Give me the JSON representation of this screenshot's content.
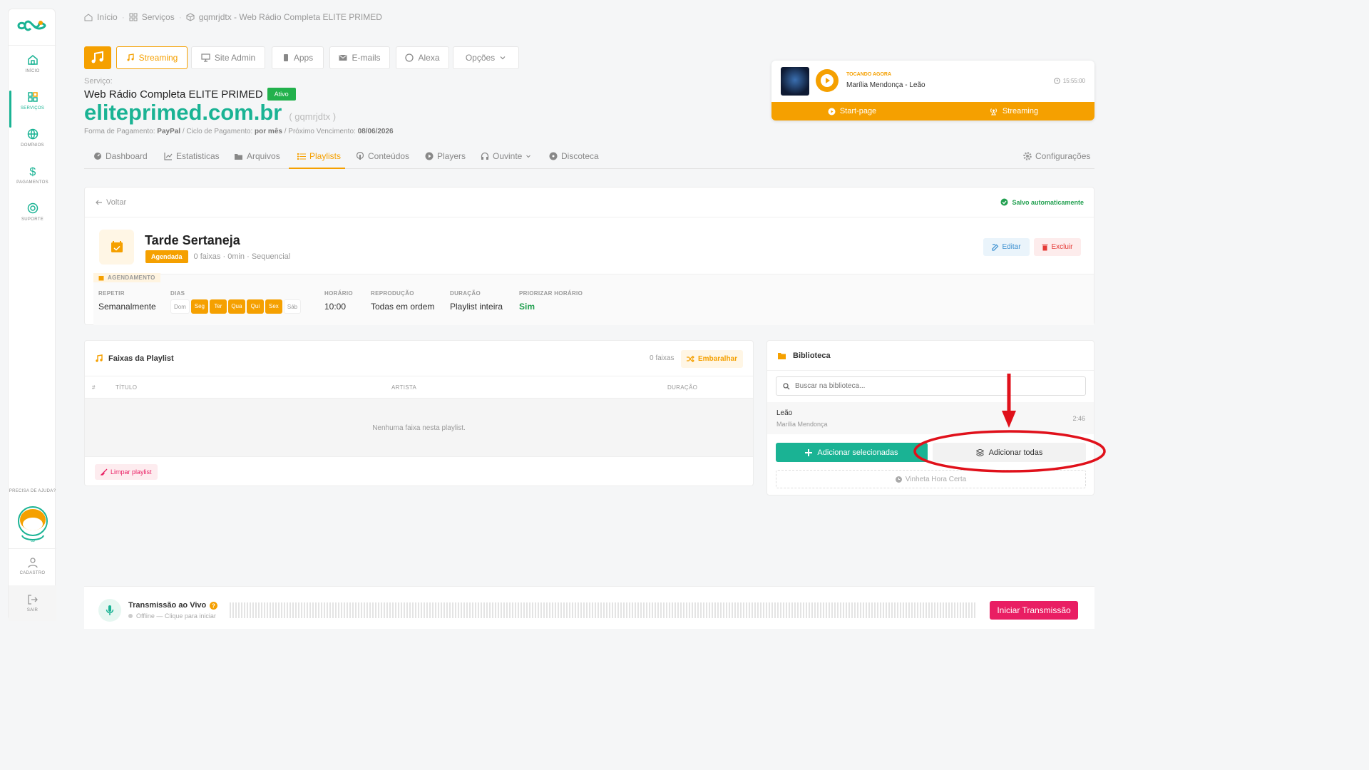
{
  "sidebar": {
    "items": [
      {
        "label": "INÍCIO"
      },
      {
        "label": "SERVIÇOS"
      },
      {
        "label": "DOMÍNIOS"
      },
      {
        "label": "PAGAMENTOS"
      },
      {
        "label": "SUPORTE"
      }
    ],
    "help": "PRECISA DE AJUDA?",
    "account": "CADASTRO",
    "logout": "SAIR"
  },
  "breadcrumb": [
    "Início",
    "Serviços",
    "gqmrjdtx - Web Rádio Completa ELITE PRIMED"
  ],
  "toptabs": [
    "Streaming",
    "Site Admin",
    "Apps",
    "E-mails",
    "Alexa",
    "Opções"
  ],
  "service": {
    "label": "Serviço:",
    "name": "Web Rádio Completa ELITE PRIMED",
    "status": "Ativo",
    "domain": "eliteprimed.com.br",
    "code": "( gqmrjdtx )",
    "pay_label": "Forma de Pagamento:",
    "pay": "PayPal",
    "cycle_label": "/ Ciclo de Pagamento:",
    "cycle": "por mês",
    "due_label": "/ Próximo Vencimento:",
    "due": "08/06/2026"
  },
  "nowplaying": {
    "label": "TOCANDO AGORA",
    "track": "Marília Mendonça - Leão",
    "time": "15:55:00",
    "startpage": "Start-page",
    "streaming": "Streaming"
  },
  "subtabs": [
    "Dashboard",
    "Estatisticas",
    "Arquivos",
    "Playlists",
    "Conteúdos",
    "Players",
    "Ouvinte",
    "Discoteca"
  ],
  "settings": "Configurações",
  "playlist": {
    "back": "Voltar",
    "autosave": "Salvo automaticamente",
    "name": "Tarde Sertaneja",
    "badge": "Agendada",
    "meta": "0 faixas · 0min · Sequencial",
    "edit": "Editar",
    "delete": "Excluir",
    "schedule_label": "AGENDAMENTO",
    "repeat_label": "REPETIR",
    "repeat": "Semanalmente",
    "days_label": "DIAS",
    "days": [
      {
        "d": "Dom",
        "on": false
      },
      {
        "d": "Seg",
        "on": true
      },
      {
        "d": "Ter",
        "on": true
      },
      {
        "d": "Qua",
        "on": true
      },
      {
        "d": "Qui",
        "on": true
      },
      {
        "d": "Sex",
        "on": true
      },
      {
        "d": "Sáb",
        "on": false
      }
    ],
    "time_label": "HORÁRIO",
    "time": "10:00",
    "repro_label": "REPRODUÇÃO",
    "repro": "Todas em ordem",
    "dur_label": "DURAÇÃO",
    "dur": "Playlist inteira",
    "prio_label": "PRIORIZAR HORÁRIO",
    "prio": "Sim"
  },
  "tracks": {
    "title": "Faixas da Playlist",
    "count": "0 faixas",
    "shuffle": "Embaralhar",
    "cols": [
      "#",
      "TÍTULO",
      "ARTISTA",
      "DURAÇÃO"
    ],
    "empty": "Nenhuma faixa nesta playlist.",
    "clear": "Limpar playlist"
  },
  "library": {
    "title": "Biblioteca",
    "search_placeholder": "Buscar na biblioteca...",
    "item": {
      "title": "Leão",
      "artist": "Marília Mendonça",
      "dur": "2:46"
    },
    "add_selected": "Adicionar selecionadas",
    "add_all": "Adicionar todas",
    "vinheta": "Vinheta Hora Certa"
  },
  "live": {
    "title": "Transmissão ao Vivo",
    "status": "Offline — Clique para iniciar",
    "start": "Iniciar Transmissão"
  },
  "colors": {
    "accent": "#f5a000",
    "brand": "#1ab394",
    "danger": "#e91e63",
    "annotation": "#e0111b"
  }
}
